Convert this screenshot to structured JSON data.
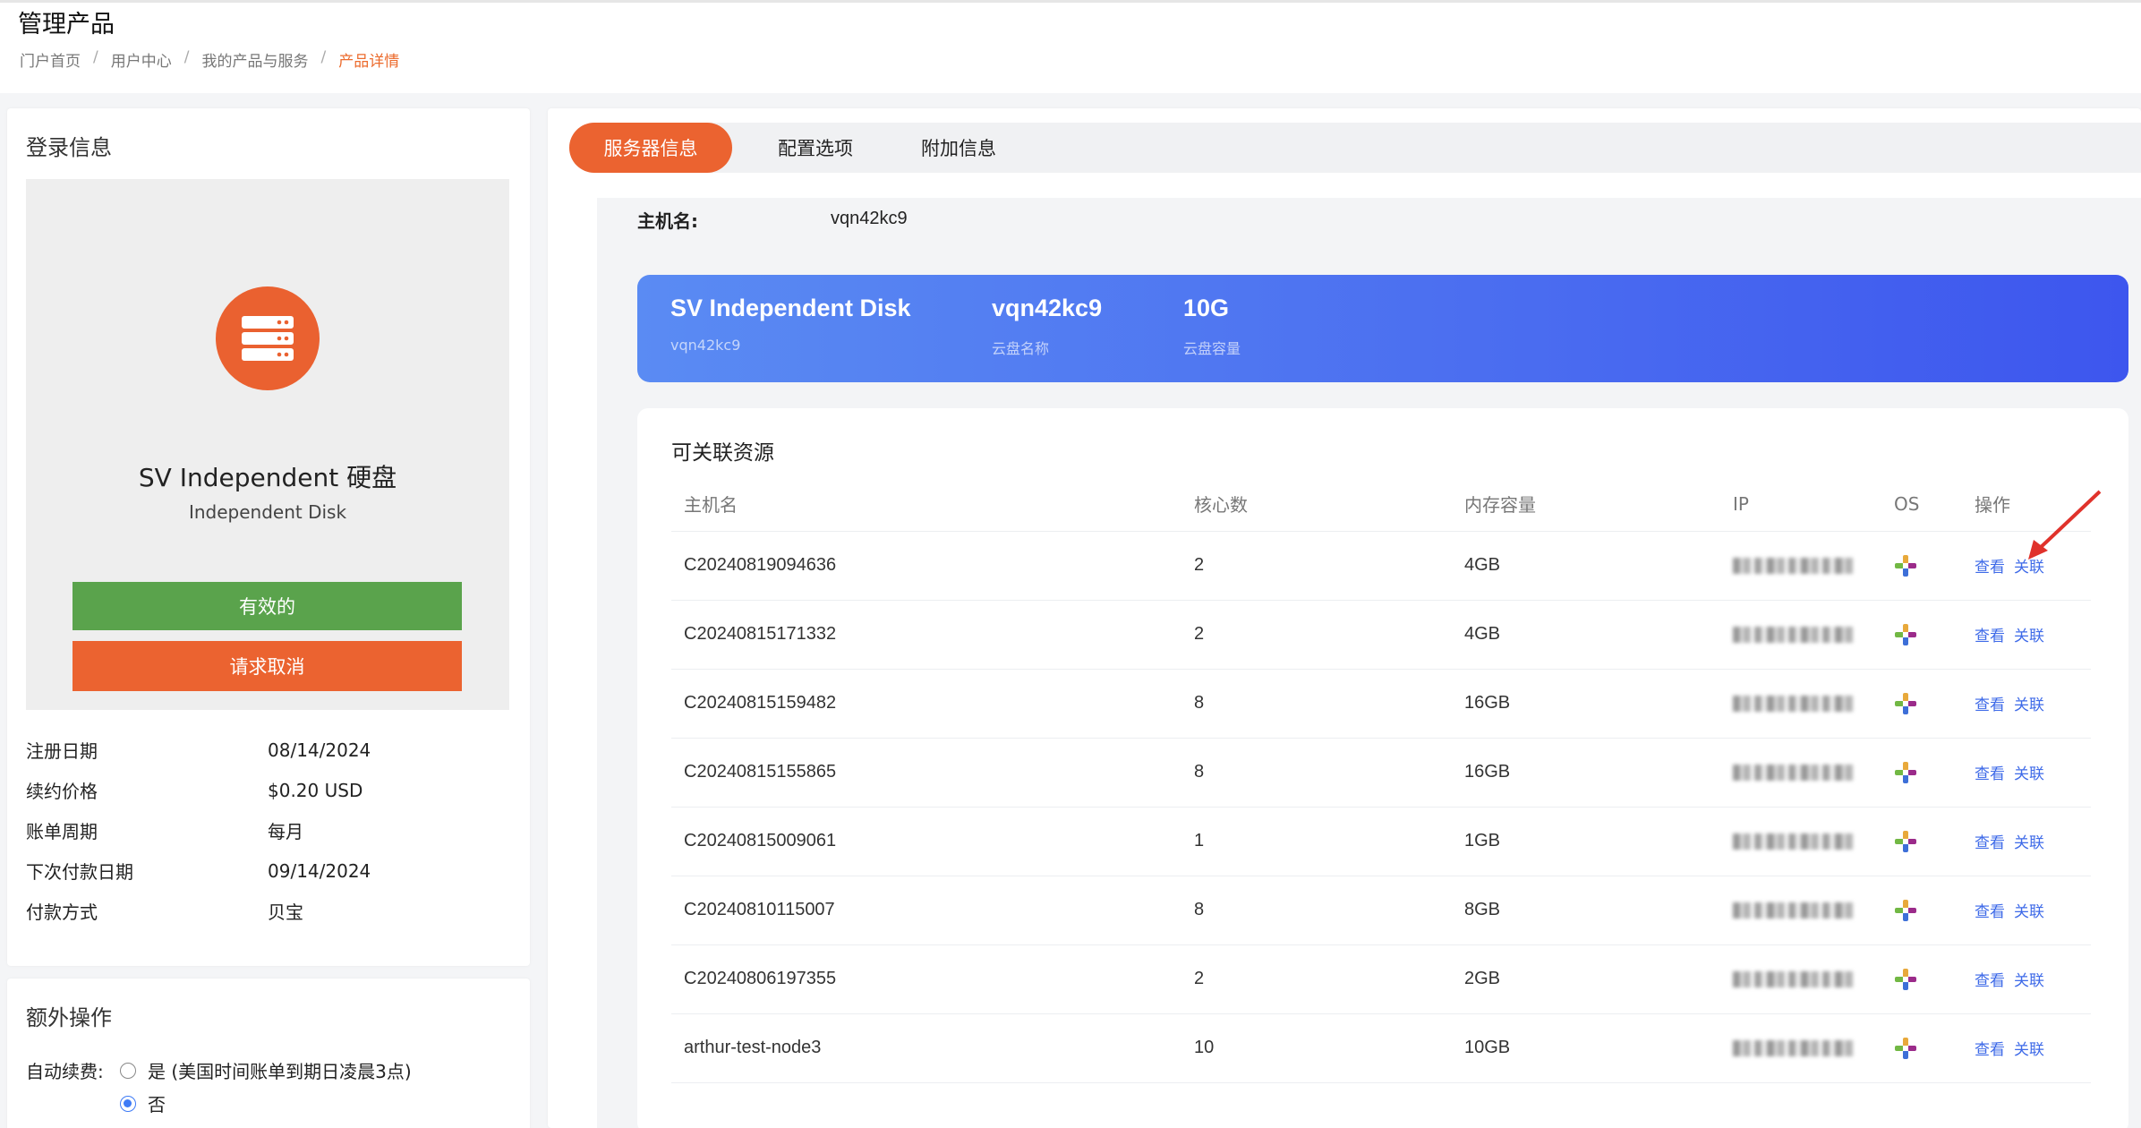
{
  "header": {
    "title": "管理产品",
    "breadcrumb": [
      "门户首页",
      "用户中心",
      "我的产品与服务",
      "产品详情"
    ]
  },
  "login_card": {
    "title": "登录信息",
    "product_name": "SV Independent 硬盘",
    "product_sub": "Independent Disk",
    "status_label": "有效的",
    "cancel_label": "请求取消",
    "info": [
      {
        "label": "注册日期",
        "value": "08/14/2024"
      },
      {
        "label": "续约价格",
        "value": "$0.20 USD"
      },
      {
        "label": "账单周期",
        "value": "每月"
      },
      {
        "label": "下次付款日期",
        "value": "09/14/2024"
      },
      {
        "label": "付款方式",
        "value": "贝宝"
      }
    ]
  },
  "extra_card": {
    "title": "额外操作",
    "auto_renew_label": "自动续费:",
    "option_yes": "是 (美国时间账单到期日凌晨3点)",
    "option_no": "否",
    "selected": "否"
  },
  "tabs": [
    {
      "label": "服务器信息",
      "active": true
    },
    {
      "label": "配置选项",
      "active": false
    },
    {
      "label": "附加信息",
      "active": false
    }
  ],
  "server": {
    "hostname_label": "主机名:",
    "hostname_value": "vqn42kc9"
  },
  "banner": {
    "name": "SV Independent Disk",
    "name_sub": "vqn42kc9",
    "disk_name": "vqn42kc9",
    "disk_name_label": "云盘名称",
    "capacity": "10G",
    "capacity_label": "云盘容量"
  },
  "resources": {
    "title": "可关联资源",
    "columns": [
      "主机名",
      "核心数",
      "内存容量",
      "IP",
      "OS",
      "操作"
    ],
    "view_label": "查看",
    "link_label": "关联",
    "rows": [
      {
        "host": "C20240819094636",
        "cores": "2",
        "mem": "4GB"
      },
      {
        "host": "C20240815171332",
        "cores": "2",
        "mem": "4GB"
      },
      {
        "host": "C20240815159482",
        "cores": "8",
        "mem": "16GB"
      },
      {
        "host": "C20240815155865",
        "cores": "8",
        "mem": "16GB"
      },
      {
        "host": "C20240815009061",
        "cores": "1",
        "mem": "1GB"
      },
      {
        "host": "C20240810115007",
        "cores": "8",
        "mem": "8GB"
      },
      {
        "host": "C20240806197355",
        "cores": "2",
        "mem": "2GB"
      },
      {
        "host": "arthur-test-node3",
        "cores": "10",
        "mem": "10GB"
      }
    ]
  },
  "colors": {
    "accent_orange": "#eb6330",
    "status_green": "#5aa34c",
    "link_blue": "#3e6ae8",
    "banner_blue": "#4a6cf0"
  }
}
